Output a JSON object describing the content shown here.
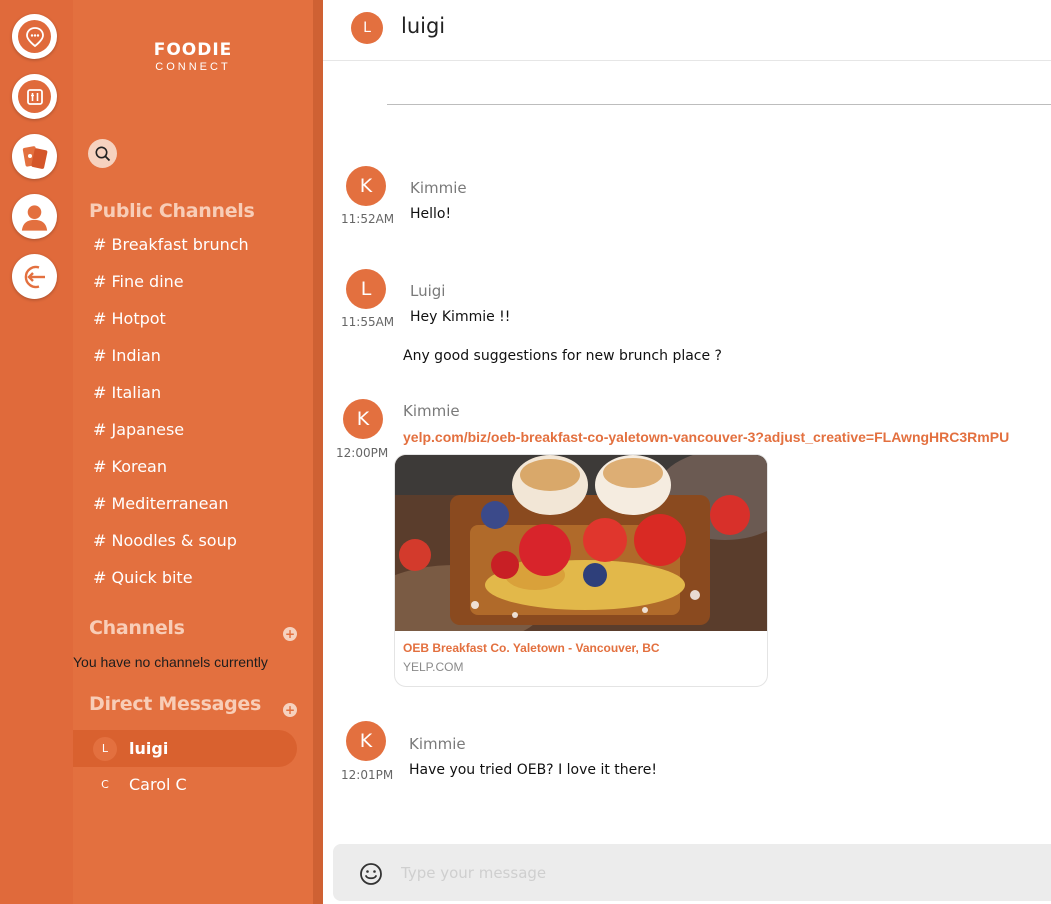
{
  "brand": {
    "name": "FOODIE",
    "subtitle": "CONNECT"
  },
  "rail": {
    "items": [
      {
        "icon": "chat-pin-icon"
      },
      {
        "icon": "restaurant-icon"
      },
      {
        "icon": "cards-icon"
      },
      {
        "icon": "user-icon"
      },
      {
        "icon": "logout-icon"
      }
    ]
  },
  "search": {
    "icon": "search-icon"
  },
  "public_channels": {
    "title": "Public Channels",
    "items": [
      "# Breakfast brunch",
      "# Fine dine",
      "# Hotpot",
      "# Indian",
      "# Italian",
      "# Japanese",
      "# Korean",
      "# Mediterranean",
      "# Noodles & soup",
      "# Quick bite"
    ]
  },
  "channels": {
    "title": "Channels",
    "empty_text": "You have no channels currently",
    "add_icon": "+"
  },
  "direct_messages": {
    "title": "Direct Messages",
    "add_icon": "+",
    "items": [
      {
        "initial": "L",
        "name": "luigi",
        "active": true
      },
      {
        "initial": "C",
        "name": "Carol C",
        "active": false
      }
    ]
  },
  "chat_header": {
    "initial": "L",
    "title": "luigi"
  },
  "messages": [
    {
      "initial": "K",
      "author": "Kimmie",
      "time": "11:52AM",
      "lines": [
        "Hello!"
      ]
    },
    {
      "initial": "L",
      "author": "Luigi",
      "time": "11:55AM",
      "lines": [
        "Hey Kimmie !!",
        "Any good suggestions for new brunch place ?"
      ]
    },
    {
      "initial": "K",
      "author": "Kimmie",
      "time": "12:00PM",
      "link": "yelp.com/biz/oeb-breakfast-co-yaletown-vancouver-3?adjust_creative=FLAwngHRC3RmPU",
      "preview": {
        "title": "OEB Breakfast Co. Yaletown - Vancouver, BC",
        "domain": "YELP.COM"
      }
    },
    {
      "initial": "K",
      "author": "Kimmie",
      "time": "12:01PM",
      "lines": [
        "Have you tried OEB? I love it there!"
      ]
    }
  ],
  "composer": {
    "placeholder": "Type your message",
    "emoji_icon": "smiley-icon"
  },
  "colors": {
    "accent": "#e3703f",
    "rail": "#e06a3b",
    "section_title": "#f8cdb7"
  }
}
